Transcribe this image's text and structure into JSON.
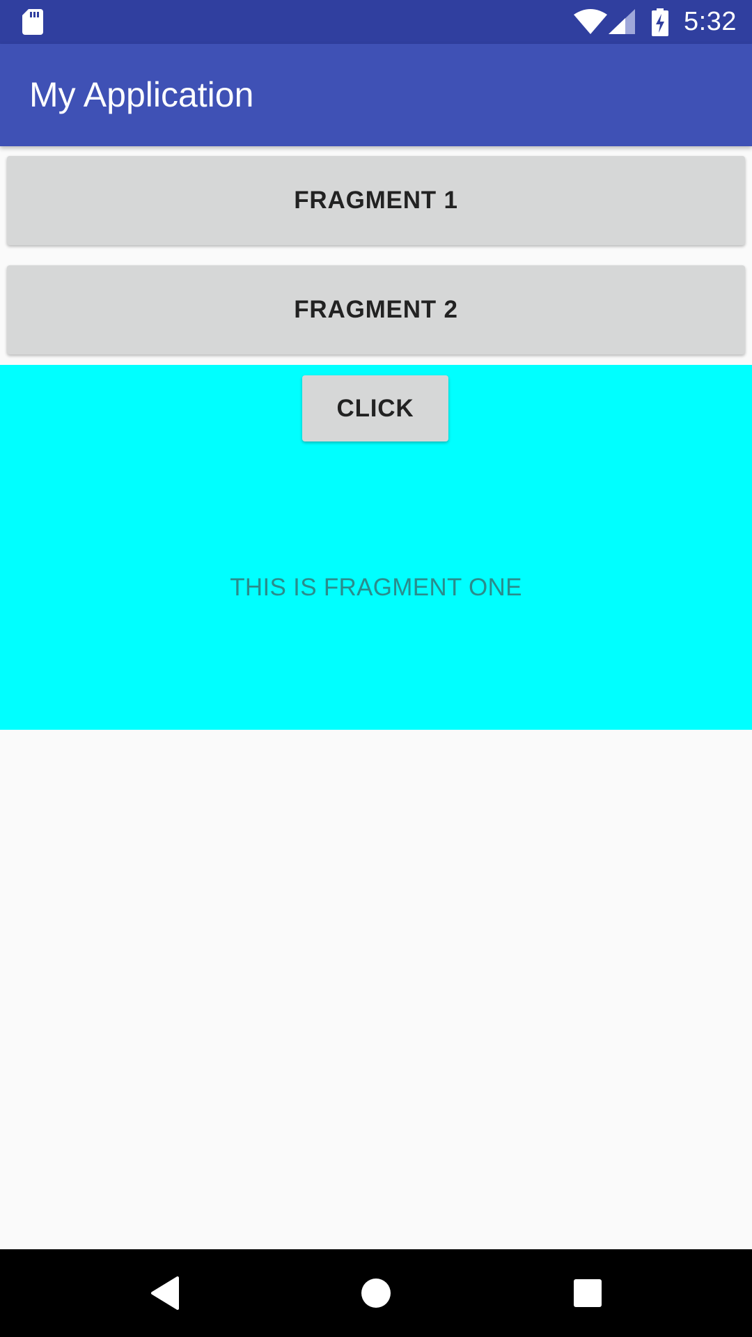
{
  "status_bar": {
    "time": "5:32",
    "icons": [
      "sd-card-icon",
      "wifi-icon",
      "signal-icon",
      "battery-charging-icon"
    ],
    "background": "#303f9f"
  },
  "app_bar": {
    "title": "My Application",
    "background": "#3f51b5"
  },
  "buttons": {
    "fragment1_label": "FRAGMENT 1",
    "fragment2_label": "FRAGMENT 2"
  },
  "fragment": {
    "background": "#00ffff",
    "click_label": "CLICK",
    "text": "THIS IS FRAGMENT ONE"
  },
  "nav_bar": {
    "icons": [
      "back-icon",
      "home-icon",
      "recents-icon"
    ]
  }
}
